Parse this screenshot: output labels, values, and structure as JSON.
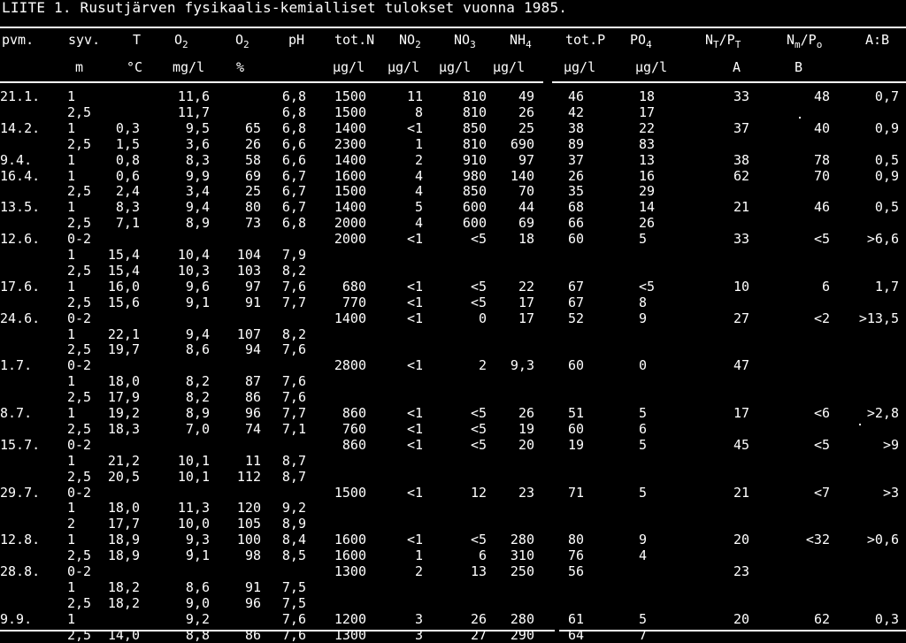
{
  "title": "LIITE 1. Rusutjärven fysikaalis-kemialliset tulokset vuonna 1985.",
  "headers": [
    {
      "main": "pvm.",
      "sub": ""
    },
    {
      "main": "syv.",
      "sub": ""
    },
    {
      "main": "T",
      "sub": ""
    },
    {
      "main": "O",
      "sub": "2"
    },
    {
      "main": "O",
      "sub": "2"
    },
    {
      "main": "pH",
      "sub": ""
    },
    {
      "main": "tot.N",
      "sub": ""
    },
    {
      "main": "NO",
      "sub": "2"
    },
    {
      "main": "NO",
      "sub": "3"
    },
    {
      "main": "NH",
      "sub": "4"
    },
    {
      "main": "tot.P",
      "sub": ""
    },
    {
      "main": "PO",
      "sub": "4"
    },
    {
      "main": "N",
      "sub": "T",
      "main2": "/P",
      "sub2": "T"
    },
    {
      "main": "N",
      "sub": "m",
      "main2": "/P",
      "sub2": "o"
    },
    {
      "main": "A:B",
      "sub": ""
    }
  ],
  "units": [
    "",
    "m",
    "°C",
    "mg/l",
    "%",
    "",
    "µg/l",
    "µg/l",
    "µg/l",
    "µg/l",
    "µg/l",
    "µg/l",
    "A",
    "B",
    ""
  ],
  "rows": [
    [
      "21.1.",
      "1",
      "",
      "11,6",
      "",
      "6,8",
      "1500",
      "11",
      "810",
      "49",
      "46",
      "18",
      "33",
      "48",
      "0,7"
    ],
    [
      "",
      "2,5",
      "",
      "11,7",
      "",
      "6,8",
      "1500",
      "8",
      "810",
      "26",
      "42",
      "17",
      "",
      "",
      ""
    ],
    [
      "14.2.",
      "1",
      "0,3",
      "9,5",
      "65",
      "6,8",
      "1400",
      "<1",
      "850",
      "25",
      "38",
      "22",
      "37",
      "40",
      "0,9"
    ],
    [
      "",
      "2,5",
      "1,5",
      "3,6",
      "26",
      "6,6",
      "2300",
      "1",
      "810",
      "690",
      "89",
      "83",
      "",
      "",
      ""
    ],
    [
      "9.4.",
      "1",
      "0,8",
      "8,3",
      "58",
      "6,6",
      "1400",
      "2",
      "910",
      "97",
      "37",
      "13",
      "38",
      "78",
      "0,5"
    ],
    [
      "16.4.",
      "1",
      "0,6",
      "9,9",
      "69",
      "6,7",
      "1600",
      "4",
      "980",
      "140",
      "26",
      "16",
      "62",
      "70",
      "0,9"
    ],
    [
      "",
      "2,5",
      "2,4",
      "3,4",
      "25",
      "6,7",
      "1500",
      "4",
      "850",
      "70",
      "35",
      "29",
      "",
      "",
      ""
    ],
    [
      "13.5.",
      "1",
      "8,3",
      "9,4",
      "80",
      "6,7",
      "1400",
      "5",
      "600",
      "44",
      "68",
      "14",
      "21",
      "46",
      "0,5"
    ],
    [
      "",
      "2,5",
      "7,1",
      "8,9",
      "73",
      "6,8",
      "2000",
      "4",
      "600",
      "69",
      "66",
      "26",
      "",
      "",
      ""
    ],
    [
      "12.6.",
      "0-2",
      "",
      "",
      "",
      "",
      "2000",
      "<1",
      "<5",
      "18",
      "60",
      "5",
      "33",
      "<5",
      ">6,6"
    ],
    [
      "",
      "1",
      "15,4",
      "10,4",
      "104",
      "7,9",
      "",
      "",
      "",
      "",
      "",
      "",
      "",
      "",
      ""
    ],
    [
      "",
      "2,5",
      "15,4",
      "10,3",
      "103",
      "8,2",
      "",
      "",
      "",
      "",
      "",
      "",
      "",
      "",
      ""
    ],
    [
      "17.6.",
      "1",
      "16,0",
      "9,6",
      "97",
      "7,6",
      "680",
      "<1",
      "<5",
      "22",
      "67",
      "<5",
      "10",
      "6",
      "1,7"
    ],
    [
      "",
      "2,5",
      "15,6",
      "9,1",
      "91",
      "7,7",
      "770",
      "<1",
      "<5",
      "17",
      "67",
      "8",
      "",
      "",
      ""
    ],
    [
      "24.6.",
      "0-2",
      "",
      "",
      "",
      "",
      "1400",
      "<1",
      "0",
      "17",
      "52",
      "9",
      "27",
      "<2",
      ">13,5"
    ],
    [
      "",
      "1",
      "22,1",
      "9,4",
      "107",
      "8,2",
      "",
      "",
      "",
      "",
      "",
      "",
      "",
      "",
      ""
    ],
    [
      "",
      "2,5",
      "19,7",
      "8,6",
      "94",
      "7,6",
      "",
      "",
      "",
      "",
      "",
      "",
      "",
      "",
      ""
    ],
    [
      "1.7.",
      "0-2",
      "",
      "",
      "",
      "",
      "2800",
      "<1",
      "2",
      "9,3",
      "60",
      "0",
      "47",
      "",
      ""
    ],
    [
      "",
      "1",
      "18,0",
      "8,2",
      "87",
      "7,6",
      "",
      "",
      "",
      "",
      "",
      "",
      "",
      "",
      ""
    ],
    [
      "",
      "2,5",
      "17,9",
      "8,2",
      "86",
      "7,6",
      "",
      "",
      "",
      "",
      "",
      "",
      "",
      "",
      ""
    ],
    [
      "8.7.",
      "1",
      "19,2",
      "8,9",
      "96",
      "7,7",
      "860",
      "<1",
      "<5",
      "26",
      "51",
      "5",
      "17",
      "<6",
      ">2,8"
    ],
    [
      "",
      "2,5",
      "18,3",
      "7,0",
      "74",
      "7,1",
      "760",
      "<1",
      "<5",
      "19",
      "60",
      "6",
      "",
      "",
      ""
    ],
    [
      "15.7.",
      "0-2",
      "",
      "",
      "",
      "",
      "860",
      "<1",
      "<5",
      "20",
      "19",
      "5",
      "45",
      "<5",
      ">9"
    ],
    [
      "",
      "1",
      "21,2",
      "10,1",
      "11",
      "8,7",
      "",
      "",
      "",
      "",
      "",
      "",
      "",
      "",
      ""
    ],
    [
      "",
      "2,5",
      "20,5",
      "10,1",
      "112",
      "8,7",
      "",
      "",
      "",
      "",
      "",
      "",
      "",
      "",
      ""
    ],
    [
      "29.7.",
      "0-2",
      "",
      "",
      "",
      "",
      "1500",
      "<1",
      "12",
      "23",
      "71",
      "5",
      "21",
      "<7",
      ">3"
    ],
    [
      "",
      "1",
      "18,0",
      "11,3",
      "120",
      "9,2",
      "",
      "",
      "",
      "",
      "",
      "",
      "",
      "",
      ""
    ],
    [
      "",
      "2",
      "17,7",
      "10,0",
      "105",
      "8,9",
      "",
      "",
      "",
      "",
      "",
      "",
      "",
      "",
      ""
    ],
    [
      "12.8.",
      "1",
      "18,9",
      "9,3",
      "100",
      "8,4",
      "1600",
      "<1",
      "<5",
      "280",
      "80",
      "9",
      "20",
      "<32",
      ">0,6"
    ],
    [
      "",
      "2,5",
      "18,9",
      "9,1",
      "98",
      "8,5",
      "1600",
      "1",
      "6",
      "310",
      "76",
      "4",
      "",
      "",
      ""
    ],
    [
      "28.8.",
      "0-2",
      "",
      "",
      "",
      "",
      "1300",
      "2",
      "13",
      "250",
      "56",
      "",
      "23",
      "",
      ""
    ],
    [
      "",
      "1",
      "18,2",
      "8,6",
      "91",
      "7,5",
      "",
      "",
      "",
      "",
      "",
      "",
      "",
      "",
      ""
    ],
    [
      "",
      "2,5",
      "18,2",
      "9,0",
      "96",
      "7,5",
      "",
      "",
      "",
      "",
      "",
      "",
      "",
      "",
      ""
    ],
    [
      "9.9.",
      "1",
      "",
      "9,2",
      "",
      "7,6",
      "1200",
      "3",
      "26",
      "280",
      "61",
      "5",
      "20",
      "62",
      "0,3"
    ],
    [
      "",
      "2,5",
      "14,0",
      "8,8",
      "86",
      "7,6",
      "1300",
      "3",
      "27",
      "290",
      "64",
      "7",
      "",
      "",
      ""
    ]
  ]
}
